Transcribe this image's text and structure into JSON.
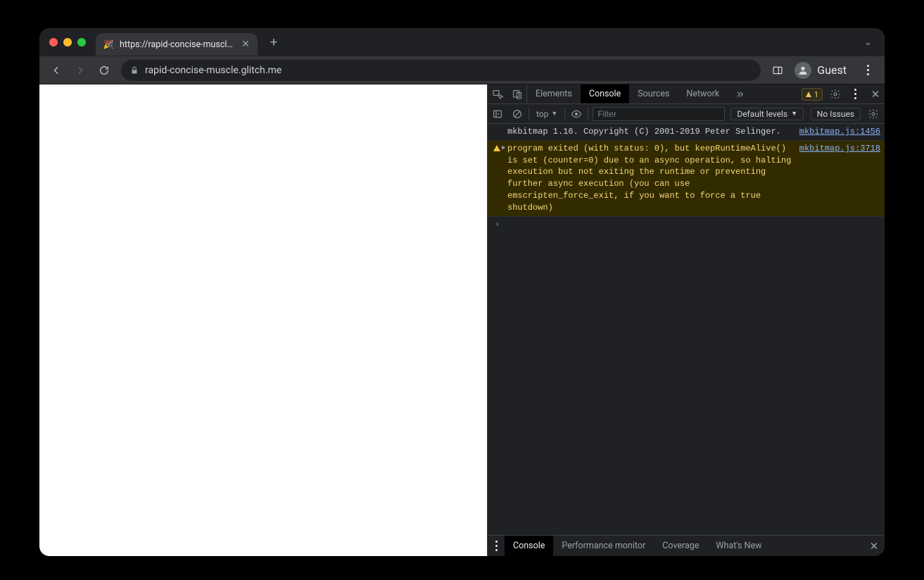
{
  "tab": {
    "title": "https://rapid-concise-muscle.g",
    "favicon": "🎉"
  },
  "toolbar": {
    "url": "rapid-concise-muscle.glitch.me",
    "guest_label": "Guest"
  },
  "devtools": {
    "tabs": {
      "elements": "Elements",
      "console": "Console",
      "sources": "Sources",
      "network": "Network"
    },
    "warning_count": "1",
    "console_toolbar": {
      "context": "top",
      "filter_placeholder": "Filter",
      "levels": "Default levels",
      "issues": "No Issues"
    },
    "messages": {
      "info_text": "mkbitmap 1.16. Copyright (C) 2001-2019 Peter Selinger.",
      "info_src": "mkbitmap.js:1456",
      "warn_text": "program exited (with status: 0), but keepRuntimeAlive() is set (counter=0) due to an async operation, so halting execution but not exiting the runtime or preventing further async execution (you can use emscripten_force_exit, if you want to force a true shutdown)",
      "warn_src": "mkbitmap.js:3718"
    },
    "drawer": {
      "console": "Console",
      "perf": "Performance monitor",
      "coverage": "Coverage",
      "whatsnew": "What's New"
    }
  }
}
